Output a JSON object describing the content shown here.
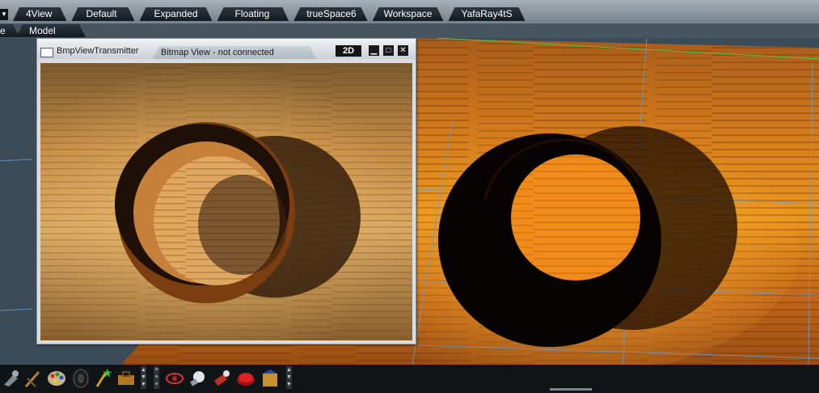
{
  "layout_tabs": [
    "4View",
    "Default",
    "Expanded",
    "Floating",
    "trueSpace6",
    "Workspace",
    "YafaRay4tS"
  ],
  "view_tabs": [
    "e",
    "Model"
  ],
  "bitmap_window": {
    "app_name": "BmpViewTransmitter",
    "tab_label": "Bitmap View - not connected",
    "mode_button": "2D",
    "minimize_icon": "minimize-icon",
    "maximize_icon": "maximize-icon",
    "close_icon": "close-icon"
  },
  "toolbar": {
    "icons": [
      "pick-tool-icon",
      "brush-icon",
      "palette-icon",
      "tire-icon",
      "magic-wand-icon",
      "toolbox-icon",
      "view-icon",
      "light-bulb-icon",
      "flashlight-icon",
      "spot-light-icon",
      "red-button-icon",
      "package-icon"
    ]
  },
  "colors": {
    "accent_green": "#4cc44c",
    "grid_blue": "#6a9bc8",
    "title_gradient_light": "#f2f4f6"
  }
}
